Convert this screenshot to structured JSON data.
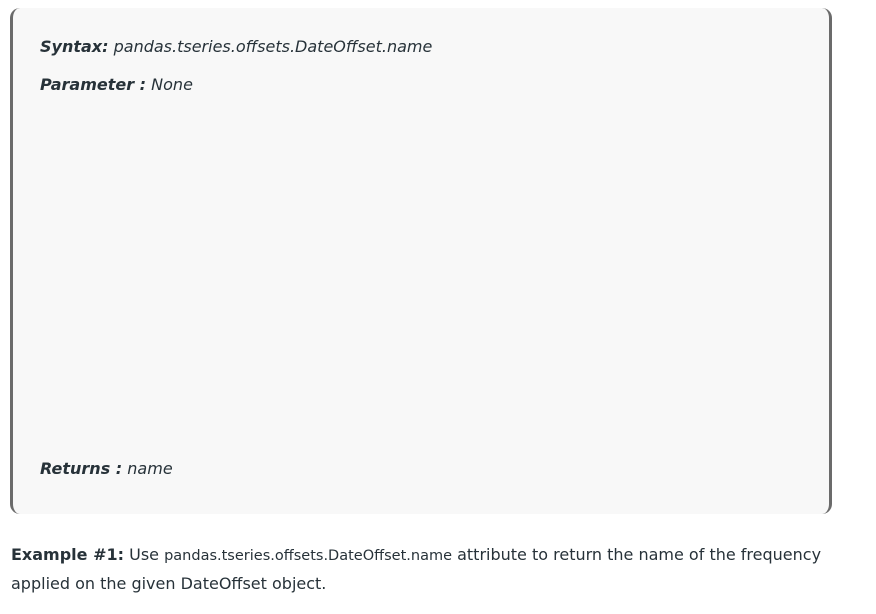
{
  "blockquote": {
    "syntax_label": "Syntax:",
    "syntax_value": "pandas.tseries.offsets.DateOffset.name",
    "parameter_label": "Parameter :",
    "parameter_value": "None",
    "returns_label": "Returns :",
    "returns_value": "name"
  },
  "example": {
    "label": "Example #1:",
    "text_before": "Use",
    "code": "pandas.tseries.offsets.DateOffset.name",
    "text_after": "attribute to return the name of the frequency applied on the given DateOffset object."
  },
  "colors": {
    "text": "#273239",
    "quote_background": "#f8f8f8",
    "quote_border": "#6b6b6b"
  }
}
